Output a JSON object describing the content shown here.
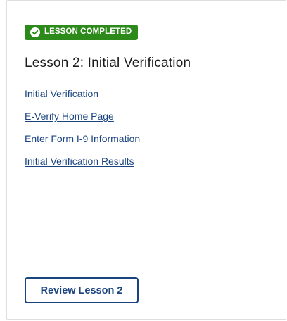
{
  "badge": {
    "label": "LESSON COMPLETED",
    "icon": "check-circle-icon",
    "color": "#2b8a1a"
  },
  "lesson": {
    "title": "Lesson 2: Initial Verification",
    "links": [
      "Initial Verification",
      "E-Verify Home Page",
      "Enter Form I-9 Information",
      "Initial Verification Results"
    ],
    "link_color": "#1a4480"
  },
  "actions": {
    "review_label": "Review Lesson 2"
  }
}
